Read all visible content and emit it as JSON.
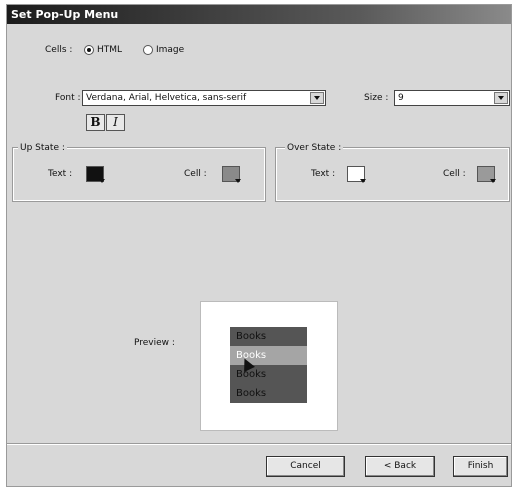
{
  "dialog": {
    "title": "Set Pop-Up Menu"
  },
  "cells": {
    "label": "Cells :",
    "options": [
      {
        "label": "HTML",
        "selected": true
      },
      {
        "label": "Image",
        "selected": false
      }
    ]
  },
  "font": {
    "label": "Font :",
    "value": "Verdana, Arial, Helvetica, sans-serif"
  },
  "size": {
    "label": "Size :",
    "value": "9"
  },
  "style_buttons": {
    "bold": "B",
    "italic": "I"
  },
  "up_state": {
    "title": "Up State :",
    "text_label": "Text :",
    "cell_label": "Cell :",
    "text_color": "#111111",
    "cell_color": "#8a8a8a"
  },
  "over_state": {
    "title": "Over State :",
    "text_label": "Text :",
    "cell_label": "Cell :",
    "text_color": "#ffffff",
    "cell_color": "#9a9a9a"
  },
  "preview": {
    "label": "Preview :",
    "items": [
      "Books",
      "Books",
      "Books",
      "Books"
    ],
    "highlighted_index": 1
  },
  "buttons": {
    "cancel": "Cancel",
    "back": "< Back",
    "finish": "Finish"
  }
}
